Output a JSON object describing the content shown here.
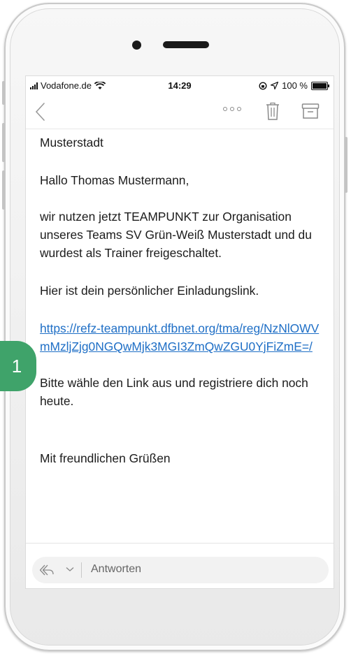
{
  "status_bar": {
    "carrier": "Vodafone.de",
    "time": "14:29",
    "battery": "100 %"
  },
  "email": {
    "line_city": "Musterstadt",
    "greeting": "Hallo Thomas Mustermann,",
    "intro": "wir nutzen jetzt TEAMPUNKT zur Organisation unseres Teams SV Grün-Weiß Musterstadt und du wurdest als Trainer freigeschaltet.",
    "link_intro": "Hier ist dein persönlicher Einladungslink.",
    "link": "https://refz-teampunkt.dfbnet.org/tma/reg/NzNlOWVmMzljZjg0NGQwMjk3MGI3ZmQwZGU0YjFiZmE=/",
    "instruction": "Bitte wähle den Link aus und registriere dich noch heute.",
    "closing": "Mit freundlichen Grüßen"
  },
  "reply_bar": {
    "label": "Antworten"
  },
  "step_badge": {
    "number": "1",
    "color": "#3fa36a"
  },
  "colors": {
    "link": "#1f6fc6",
    "icon_gray": "#8a8a8a"
  }
}
